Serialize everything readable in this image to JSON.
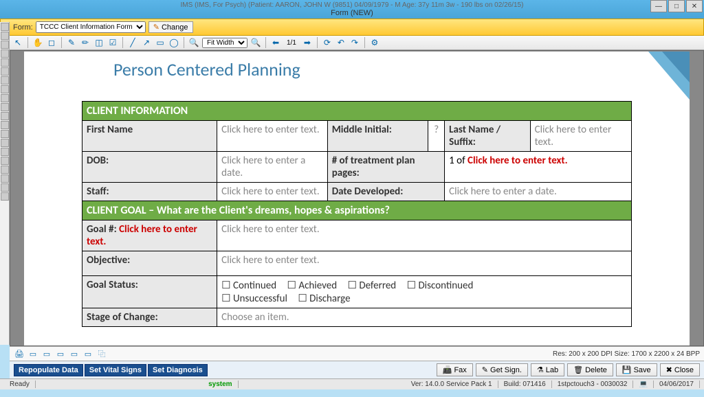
{
  "window": {
    "app_title": "IMS (IMS, For Psych)    (Patient: AARON, JOHN W (9851) 04/09/1979 - M Age: 37y 11m 3w - 190 lbs on 02/26/15)",
    "subtitle": "Form (NEW)"
  },
  "formbar": {
    "label": "Form:",
    "selected": "TCCC Client Information Form",
    "change": "Change"
  },
  "toolbar": {
    "zoom_mode": "Fit Width",
    "page_indicator": "1/1"
  },
  "document": {
    "title": "Person Centered Planning",
    "section1": "CLIENT INFORMATION",
    "first_name_label": "First Name",
    "first_name_ph": "Click here to enter text.",
    "middle_initial_label": "Middle Initial:",
    "middle_initial_val": "?",
    "last_name_label": "Last Name / Suffix:",
    "last_name_ph": "Click here to enter text.",
    "dob_label": "DOB:",
    "dob_ph": "Click here to enter a date.",
    "treatment_pages_label": "# of treatment plan pages:",
    "treatment_prefix": "1  of ",
    "treatment_ph": "Click here to enter text.",
    "staff_label": "Staff:",
    "staff_ph": "Click here to enter text.",
    "date_dev_label": "Date Developed:",
    "date_dev_ph": "Click here to enter a date.",
    "section2": "CLIENT GOAL – What are the Client's dreams, hopes & aspirations?",
    "goal_num_label": "Goal #: ",
    "goal_num_ph": "Click here to enter text.",
    "goal_ph": "Click here to enter text.",
    "objective_label": "Objective:",
    "objective_ph": "Click here to enter text.",
    "goal_status_label": "Goal Status:",
    "status_opts": [
      "Continued",
      "Achieved",
      "Deferred",
      "Discontinued",
      "Unsuccessful",
      "Discharge"
    ],
    "stage_label": "Stage of Change:",
    "stage_ph": "Choose an item."
  },
  "lower_toolbar": {
    "resolution": "Res:  200 x 200 DPI  Size: 1700 x 2200 x 24 BPP"
  },
  "actions": {
    "repopulate": "Repopulate Data",
    "vitals": "Set Vital Signs",
    "diagnosis": "Set Diagnosis",
    "fax": "Fax",
    "get_sign": "Get Sign.",
    "lab": "Lab",
    "delete": "Delete",
    "save": "Save",
    "close": "Close"
  },
  "status": {
    "ready": "Ready",
    "system": "system",
    "version": "Ver: 14.0.0 Service Pack 1",
    "build": "Build: 071416",
    "host": "1stpctouch3 - 0030032",
    "date": "04/06/2017"
  }
}
